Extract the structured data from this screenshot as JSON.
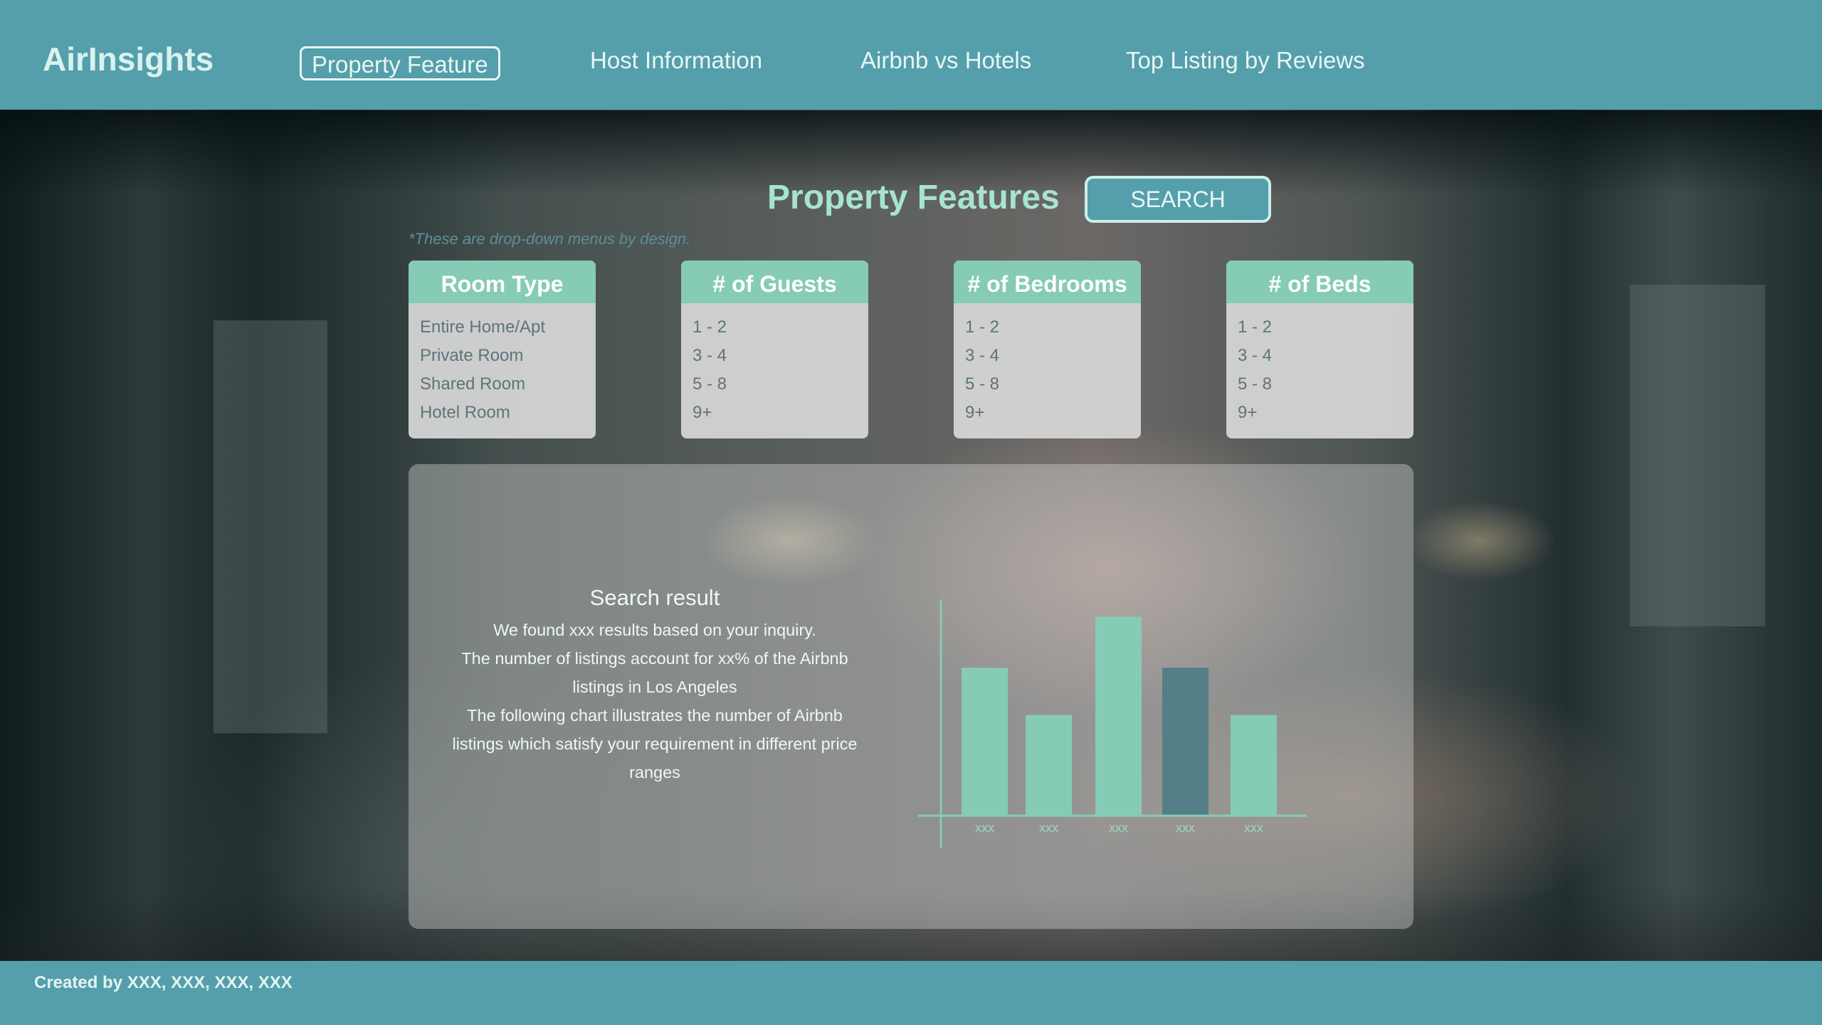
{
  "header": {
    "logo": "AirInsights",
    "nav": [
      {
        "label": "Property Feature",
        "active": true
      },
      {
        "label": "Host Information",
        "active": false
      },
      {
        "label": "Airbnb vs Hotels",
        "active": false
      },
      {
        "label": "Top Listing by Reviews",
        "active": false
      }
    ]
  },
  "main": {
    "title": "Property Features",
    "search_label": "SEARCH",
    "note": "*These are drop-down menus by design.",
    "filters": [
      {
        "title": "Room Type",
        "options": [
          "Entire Home/Apt",
          "Private Room",
          "Shared Room",
          "Hotel Room"
        ]
      },
      {
        "title": "# of Guests",
        "options": [
          "1 - 2",
          "3 - 4",
          "5 - 8",
          "9+"
        ]
      },
      {
        "title": "# of Bedrooms",
        "options": [
          "1 - 2",
          "3 - 4",
          "5 - 8",
          "9+"
        ]
      },
      {
        "title": "# of Beds",
        "options": [
          "1 - 2",
          "3 - 4",
          "5 - 8",
          "9+"
        ]
      }
    ],
    "result": {
      "title": "Search result",
      "lines": [
        "We found xxx results based on your inquiry.",
        "The number of listings account for xx% of the Airbnb listings in Los Angeles",
        "The following chart illustrates the number of Airbnb listings which satisfy your requirement in different price ranges"
      ]
    }
  },
  "chart_data": {
    "type": "bar",
    "categories": [
      "xxx",
      "xxx",
      "xxx",
      "xxx",
      "xxx"
    ],
    "values": [
      78,
      53,
      105,
      78,
      53
    ],
    "ylim": [
      0,
      115
    ],
    "grid": false,
    "highlight_index": 3,
    "colors": {
      "bar": "#86cbb5",
      "highlight": "#557f88",
      "axis": "#86cbb5",
      "tick_label": "#9fd4c6"
    }
  },
  "footer": {
    "text": "Created by XXX, XXX, XXX, XXX"
  },
  "colors": {
    "primary": "#549fab",
    "accent": "#86cbb5",
    "title": "#a7e3d2"
  }
}
